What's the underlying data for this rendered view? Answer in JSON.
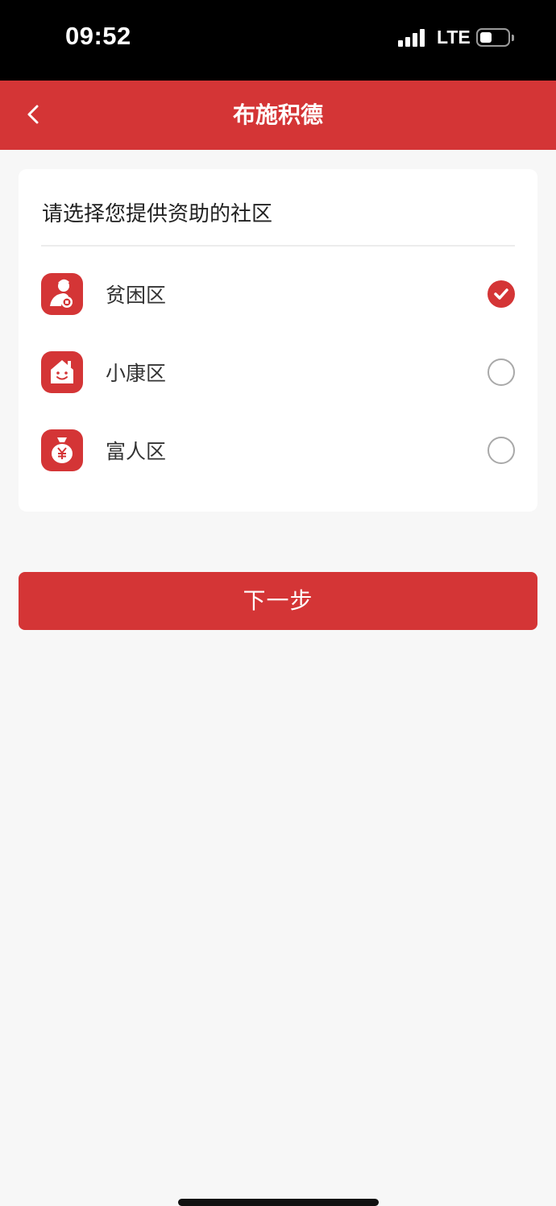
{
  "status_bar": {
    "time": "09:52",
    "network": "LTE",
    "battery_level": 0.35
  },
  "nav": {
    "back_icon": "chevron-left-icon",
    "title": "布施积德"
  },
  "card": {
    "heading": "请选择您提供资助的社区",
    "options": [
      {
        "label": "贫困区",
        "icon": "poor-district-icon",
        "selected": true
      },
      {
        "label": "小康区",
        "icon": "middle-class-house-icon",
        "selected": false
      },
      {
        "label": "富人区",
        "icon": "money-bag-icon",
        "selected": false
      }
    ]
  },
  "next_button": {
    "label": "下一步"
  },
  "colors": {
    "accent": "#d43536",
    "background": "#f7f7f7",
    "card": "#ffffff"
  }
}
